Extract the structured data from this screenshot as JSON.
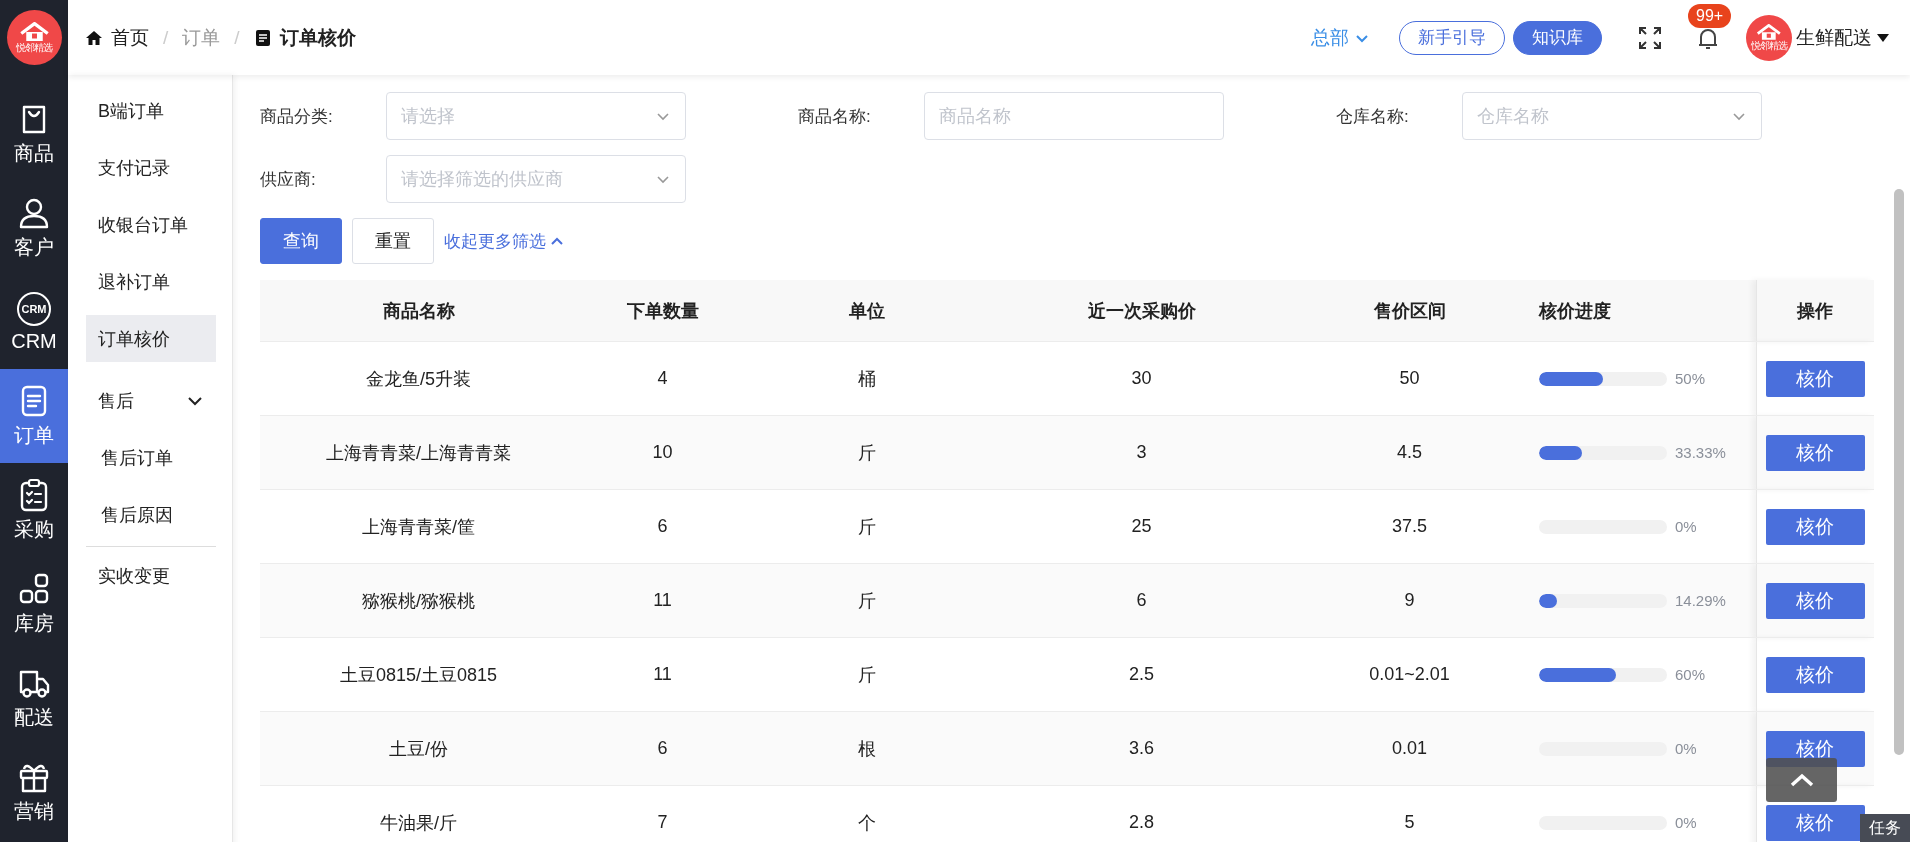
{
  "logo": {
    "text": "悦邻精选"
  },
  "rail": {
    "items": [
      {
        "label": "商品",
        "kind": "bag",
        "selected": false
      },
      {
        "label": "客户",
        "kind": "person",
        "selected": false
      },
      {
        "label": "CRM",
        "kind": "crm",
        "badge_text": "CRM",
        "selected": false
      },
      {
        "label": "订单",
        "kind": "document",
        "selected": true
      },
      {
        "label": "采购",
        "kind": "clipboard",
        "selected": false
      },
      {
        "label": "库房",
        "kind": "grid",
        "selected": false
      },
      {
        "label": "配送",
        "kind": "truck",
        "selected": false
      },
      {
        "label": "营销",
        "kind": "gift",
        "selected": false
      }
    ]
  },
  "breadcrumb": [
    {
      "kind": "home",
      "label": "首页"
    },
    {
      "kind": "separator",
      "label": "/"
    },
    {
      "kind": "link",
      "label": "订单"
    },
    {
      "kind": "separator",
      "label": "/"
    },
    {
      "kind": "current",
      "label": "订单核价"
    }
  ],
  "header": {
    "org": "总部",
    "guide_button": "新手引导",
    "kb_button": "知识库",
    "notification_badge": "99+",
    "user": "生鲜配送",
    "avatar_text": "悦邻精选"
  },
  "submenu": {
    "items": [
      {
        "kind": "item",
        "label": "B端订单",
        "selected": false
      },
      {
        "kind": "item",
        "label": "支付记录",
        "selected": false
      },
      {
        "kind": "item",
        "label": "收银台订单",
        "selected": false
      },
      {
        "kind": "item",
        "label": "退补订单",
        "selected": false
      },
      {
        "kind": "item",
        "label": "订单核价",
        "selected": true
      },
      {
        "kind": "group",
        "label": "售后",
        "expanded": true,
        "children": [
          {
            "kind": "item",
            "label": "售后订单",
            "selected": false
          },
          {
            "kind": "item",
            "label": "售后原因",
            "selected": false
          }
        ]
      },
      {
        "kind": "divider"
      },
      {
        "kind": "item",
        "label": "实收变更",
        "selected": false
      }
    ]
  },
  "filters": [
    {
      "label": "商品分类:",
      "kind": "select",
      "placeholder": "请选择"
    },
    {
      "label": "商品名称:",
      "kind": "input",
      "placeholder": "商品名称"
    },
    {
      "label": "仓库名称:",
      "kind": "select",
      "placeholder": "仓库名称"
    },
    {
      "label": "供应商:",
      "kind": "select",
      "placeholder": "请选择筛选的供应商"
    }
  ],
  "actions": {
    "query": "查询",
    "reset": "重置",
    "collapse": "收起更多筛选"
  },
  "table": {
    "columns": [
      "商品名称",
      "下单数量",
      "单位",
      "近一次采购价",
      "售价区间",
      "核价进度",
      "操作"
    ],
    "rows": [
      {
        "name": "金龙鱼/5升装",
        "qty": "4",
        "unit": "桶",
        "last_price": "30",
        "price_range": "50",
        "level": 0.5,
        "reading": "50%",
        "action": "核价"
      },
      {
        "name": "上海青青菜/上海青青菜",
        "qty": "10",
        "unit": "斤",
        "last_price": "3",
        "price_range": "4.5",
        "level": 0.3333,
        "reading": "33.33%",
        "action": "核价"
      },
      {
        "name": "上海青青菜/筐",
        "qty": "6",
        "unit": "斤",
        "last_price": "25",
        "price_range": "37.5",
        "level": 0,
        "reading": "0%",
        "action": "核价"
      },
      {
        "name": "猕猴桃/猕猴桃",
        "qty": "11",
        "unit": "斤",
        "last_price": "6",
        "price_range": "9",
        "level": 0.1429,
        "reading": "14.29%",
        "action": "核价"
      },
      {
        "name": "土豆0815/土豆0815",
        "qty": "11",
        "unit": "斤",
        "last_price": "2.5",
        "price_range": "0.01~2.01",
        "level": 0.6,
        "reading": "60%",
        "action": "核价"
      },
      {
        "name": "土豆/份",
        "qty": "6",
        "unit": "根",
        "last_price": "3.6",
        "price_range": "0.01",
        "level": 0,
        "reading": "0%",
        "action": "核价"
      },
      {
        "name": "牛油果/斤",
        "qty": "7",
        "unit": "个",
        "last_price": "2.8",
        "price_range": "5",
        "level": 0,
        "reading": "0%",
        "action": "核价"
      }
    ]
  },
  "task_tab": "任务"
}
